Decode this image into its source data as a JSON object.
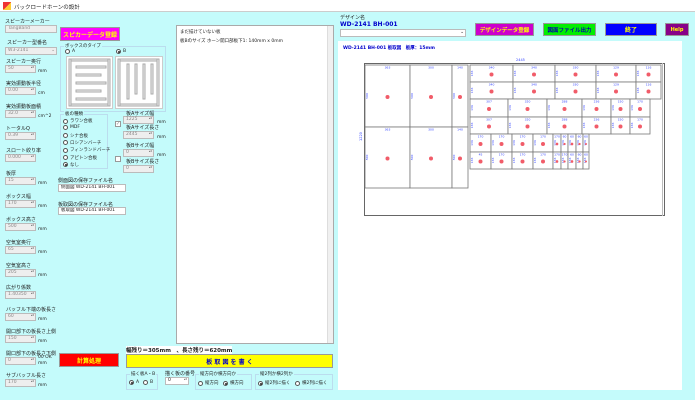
{
  "window": {
    "title": "バックロードホーンの設計"
  },
  "left": {
    "maker_label": "スピーカーメーカー",
    "maker_value": "TangBand",
    "model_label": "スピーカー型番名",
    "model_value": "W3-2141",
    "fields": [
      {
        "label": "スピーカー奥行",
        "value": "50",
        "unit": "mm"
      },
      {
        "label": "実効振動板半径",
        "value": "0.00",
        "unit": "cm"
      },
      {
        "label": "実効振動板面積",
        "value": "32.0",
        "unit": "cm^2"
      },
      {
        "label": "トータルQ",
        "value": "0.39",
        "unit": ""
      },
      {
        "label": "スロート絞り率",
        "value": "0.000",
        "unit": ""
      },
      {
        "label": "板厚",
        "value": "15",
        "unit": "mm"
      },
      {
        "label": "ボックス幅",
        "value": "170",
        "unit": "mm"
      },
      {
        "label": "ボックス高さ",
        "value": "500",
        "unit": "mm"
      },
      {
        "label": "空気室奥行",
        "value": "65",
        "unit": "mm"
      },
      {
        "label": "空気室高さ",
        "value": "205",
        "unit": "mm"
      },
      {
        "label": "広がり係数",
        "value": "1.40350",
        "unit": ""
      },
      {
        "label": "バッフル下端の板長さ",
        "value": "60",
        "unit": "mm"
      },
      {
        "label": "開口部下の板長さ上側",
        "value": "150",
        "unit": "mm"
      },
      {
        "label": "開口部下の板長さ下側",
        "value": "0",
        "unit": "mm",
        "note": "00 OK"
      },
      {
        "label": "サブバッフル長さ",
        "value": "170",
        "unit": "mm"
      }
    ]
  },
  "middle": {
    "speaker_register": "スピカーデータ登録",
    "box_type_label": "ボックスのタイプ",
    "box_type_a": "A",
    "box_type_b": "B",
    "board_kind_label": "板の種類",
    "board_kinds": [
      "ラワン合板",
      "MDF",
      "シナ合板",
      "ロシアンバーチ",
      "フィンランドバーチ",
      "アピトン合板",
      "なし"
    ],
    "board_a_width_label": "板Aサイズ幅",
    "board_a_width": "1225",
    "board_a_length_label": "板Aサイズ長さ",
    "board_a_length": "2445",
    "board_b_width_label": "板Bサイズ幅",
    "board_b_width": "0",
    "board_b_length_label": "板Bサイズ長さ",
    "board_b_length": "0",
    "mm": "mm",
    "side_file_label": "側面図の保存ファイル名",
    "side_file_value": "側面図 WD-2141 BH-001",
    "cut_file_label": "板取図の保存ファイル名",
    "cut_file_value": "板取図 WD-2141 BH-001",
    "calc_button": "計算処理"
  },
  "log": {
    "lines": [
      "まだ描けていない板",
      "板Bのサイズ ホーン開口部板下1: 140mm x 0mm"
    ]
  },
  "bottom": {
    "remaining": "幅残り＝305mm　、長さ残り＝620mm",
    "draw_button": "板 取 図 を 書 く",
    "board_ab_label": "描く板A・B",
    "board_a": "A",
    "board_b": "B",
    "board_no_label": "描く板の番号",
    "board_no": "0",
    "dir_label": "縦方向か横方向か",
    "dir_v": "縦方向",
    "dir_h": "横方向",
    "cols_label": "縦2列か横2列か",
    "cols_v": "縦2列に描く",
    "cols_h": "横2列に描く"
  },
  "right": {
    "design_label": "デザイン名",
    "design_name": "WD-2141 BH-001",
    "design_register": "デザインデータ登録",
    "export": "図面ファイル出力",
    "exit": "終了",
    "help": "Help",
    "diagram_title": "WD-2141 BH-001 板取図　板厚：15mm",
    "board_width_label": "2445",
    "board_height_label": "1220",
    "colors": {
      "magenta": "#cc00cc",
      "green": "#00ee00",
      "blue": "#0000ff",
      "purple": "#880088",
      "red": "#ff0000",
      "yellow": "#ffff00",
      "label": "#3344ff",
      "dot": "#ee3344"
    },
    "pieces": [
      {
        "w": "363",
        "h": "500"
      },
      {
        "w": "300",
        "h": "500"
      },
      {
        "w": "140",
        "h": "500"
      },
      {
        "w": "363",
        "h": "500"
      },
      {
        "w": "300",
        "h": "500"
      },
      {
        "w": "140",
        "h": "500"
      },
      {
        "w": "340",
        "h": "136"
      },
      {
        "w": "340",
        "h": "136"
      },
      {
        "w": "330",
        "h": "136"
      },
      {
        "w": "129",
        "h": "136"
      },
      {
        "w": "116",
        "h": "136"
      },
      {
        "w": "340",
        "h": "136"
      },
      {
        "w": "340",
        "h": "136"
      },
      {
        "w": "330",
        "h": "136"
      },
      {
        "w": "129",
        "h": "136"
      },
      {
        "w": "116",
        "h": "136"
      },
      {
        "w": "307",
        "h": "136"
      },
      {
        "w": "320",
        "h": "136"
      },
      {
        "w": "288",
        "h": "136"
      },
      {
        "w": "236",
        "h": "136"
      },
      {
        "w": "150",
        "h": "136"
      },
      {
        "w": "170",
        "h": "136"
      },
      {
        "w": "307",
        "h": "136"
      },
      {
        "w": "320",
        "h": "136"
      },
      {
        "w": "288",
        "h": "136"
      },
      {
        "w": "236",
        "h": "136"
      },
      {
        "w": "150",
        "h": "136"
      },
      {
        "w": "170",
        "h": "136"
      },
      {
        "w": "170",
        "h": "136"
      },
      {
        "w": "170",
        "h": "136"
      },
      {
        "w": "170",
        "h": "136"
      },
      {
        "w": "170",
        "h": "136"
      },
      {
        "w": "170",
        "h": "136"
      },
      {
        "w": "60",
        "h": "136"
      },
      {
        "w": "60",
        "h": "136"
      },
      {
        "w": "60",
        "h": "136"
      },
      {
        "w": "60",
        "h": "136"
      },
      {
        "w": "45",
        "h": "136"
      },
      {
        "w": "170",
        "h": "136"
      },
      {
        "w": "170",
        "h": "136"
      },
      {
        "w": "170",
        "h": "136"
      },
      {
        "w": "170",
        "h": "136"
      },
      {
        "w": "170",
        "h": "136"
      },
      {
        "w": "60",
        "h": "136"
      },
      {
        "w": "60",
        "h": "136"
      },
      {
        "w": "60",
        "h": "136"
      },
      {
        "w": "60",
        "h": "136"
      },
      {
        "w": "45",
        "h": "136"
      }
    ]
  }
}
